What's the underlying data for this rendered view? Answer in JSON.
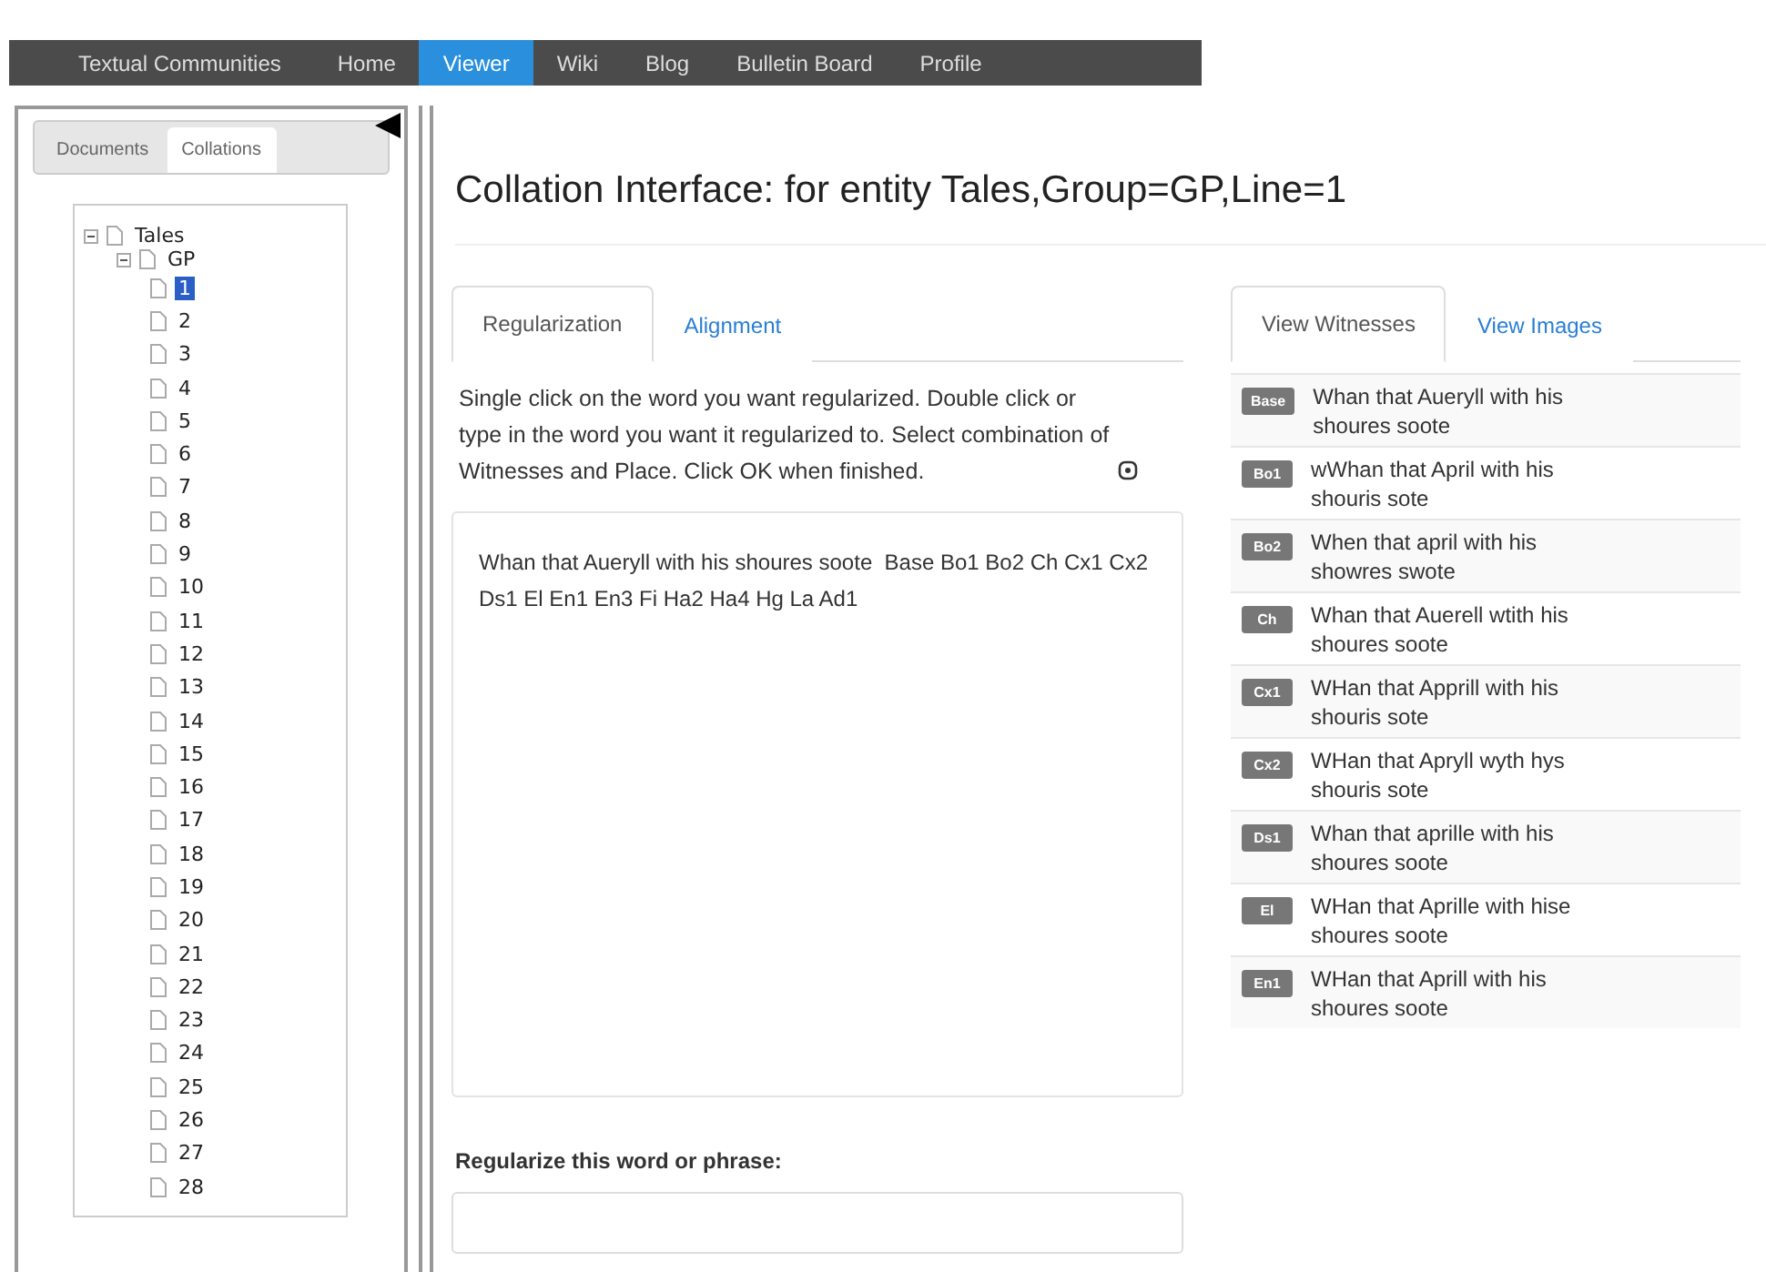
{
  "navbar": {
    "brand": "Textual Communities",
    "items": [
      {
        "label": "Home",
        "selected": false
      },
      {
        "label": "Viewer",
        "selected": true
      },
      {
        "label": "Wiki",
        "selected": false
      },
      {
        "label": "Blog",
        "selected": false
      },
      {
        "label": "Bulletin Board",
        "selected": false
      },
      {
        "label": "Profile",
        "selected": false
      }
    ]
  },
  "sidebar": {
    "tabs": [
      {
        "label": "Documents",
        "selected": false
      },
      {
        "label": "Collations",
        "selected": true
      }
    ],
    "tree": [
      {
        "label": "Tales",
        "expanded": true,
        "selected": false,
        "children": [
          {
            "label": "GP",
            "expanded": true,
            "selected": false,
            "children": [
              {
                "label": "1",
                "selected": true
              },
              {
                "label": "2",
                "selected": false
              },
              {
                "label": "3",
                "selected": false
              },
              {
                "label": "4",
                "selected": false
              },
              {
                "label": "5",
                "selected": false
              },
              {
                "label": "6",
                "selected": false
              },
              {
                "label": "7",
                "selected": false
              },
              {
                "label": "8",
                "selected": false
              },
              {
                "label": "9",
                "selected": false
              },
              {
                "label": "10",
                "selected": false
              },
              {
                "label": "11",
                "selected": false
              },
              {
                "label": "12",
                "selected": false
              },
              {
                "label": "13",
                "selected": false
              },
              {
                "label": "14",
                "selected": false
              },
              {
                "label": "15",
                "selected": false
              },
              {
                "label": "16",
                "selected": false
              },
              {
                "label": "17",
                "selected": false
              },
              {
                "label": "18",
                "selected": false
              },
              {
                "label": "19",
                "selected": false
              },
              {
                "label": "20",
                "selected": false
              },
              {
                "label": "21",
                "selected": false
              },
              {
                "label": "22",
                "selected": false
              },
              {
                "label": "23",
                "selected": false
              },
              {
                "label": "24",
                "selected": false
              },
              {
                "label": "25",
                "selected": false
              },
              {
                "label": "26",
                "selected": false
              },
              {
                "label": "27",
                "selected": false
              },
              {
                "label": "28",
                "selected": false
              }
            ]
          }
        ]
      }
    ]
  },
  "title": "Collation Interface: for entity Tales,Group=GP,Line=1",
  "editor": {
    "tabs": [
      {
        "label": "Regularization",
        "selected": true
      },
      {
        "label": "Alignment",
        "selected": false
      }
    ],
    "instructions": "Single click on the word you want regularized. Double click or type in the word you want it regularized to. Select combination of Witnesses and Place. Click OK when finished.",
    "text": "Whan that Aueryll with his shoures soote  Base Bo1 Bo2 Ch Cx1 Cx2 Ds1 El En1 En3 Fi Ha2 Ha4 Hg La Ad1",
    "regularize_label": "Regularize this word or phrase:"
  },
  "witnesses": {
    "tabs": [
      {
        "label": "View Witnesses",
        "selected": true
      },
      {
        "label": "View Images",
        "selected": false
      }
    ],
    "rows": [
      {
        "siglum": "Base",
        "text": "Whan that Aueryll with his shoures soote"
      },
      {
        "siglum": "Bo1",
        "text": "wWhan that April with his shouris sote"
      },
      {
        "siglum": "Bo2",
        "text": "When that april with his showres swote"
      },
      {
        "siglum": "Ch",
        "text": "Whan that Auerell wtith his shoures soote"
      },
      {
        "siglum": "Cx1",
        "text": "WHan that Apprill with his shouris sote"
      },
      {
        "siglum": "Cx2",
        "text": "WHan that Apryll wyth hys shouris sote"
      },
      {
        "siglum": "Ds1",
        "text": "Whan that aprille with his shoures soote"
      },
      {
        "siglum": "El",
        "text": "WHan that Aprille with hise shoures soote"
      },
      {
        "siglum": "En1",
        "text": "WHan that Aprill with his shoures soote"
      }
    ]
  }
}
